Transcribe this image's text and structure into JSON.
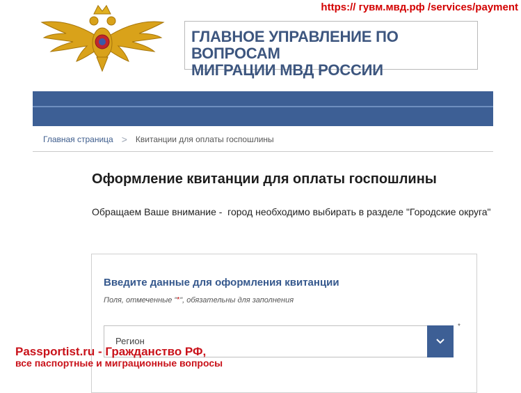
{
  "overlay": {
    "url": "https:// гувм.мвд.рф /services/payment",
    "watermark_line1": "Passportist.ru - Гражданство РФ,",
    "watermark_line2": "все паспортные и миграционные вопросы"
  },
  "header": {
    "title_line1": "ГЛАВНОЕ УПРАВЛЕНИЕ ПО ВОПРОСАМ",
    "title_line2": "МИГРАЦИИ МВД РОССИИ",
    "emblem_icon": "double-headed-eagle-emblem"
  },
  "breadcrumb": {
    "home": "Главная страница",
    "separator": ">",
    "current": "Квитанции для оплаты госпошлины"
  },
  "main": {
    "title": "Оформление квитанции для оплаты госпошлины",
    "notice": "Обращаем Ваше внимание -  город необходимо выбирать в разделе \"Городские округа\""
  },
  "form": {
    "heading": "Введите данные для оформления квитанции",
    "required_note_before": "Поля, отмеченные \"",
    "required_star": "*",
    "required_note_after": "\", обязательны для заполнения",
    "region_select": {
      "placeholder": "Регион",
      "required_marker": "*",
      "toggle_icon": "chevron-down-icon"
    }
  },
  "colors": {
    "nav": "#3d5f95",
    "title_blue": "#3d567f",
    "link_blue": "#3d5c8c",
    "overlay_red": "#d30000",
    "watermark_red": "#c9121a"
  }
}
